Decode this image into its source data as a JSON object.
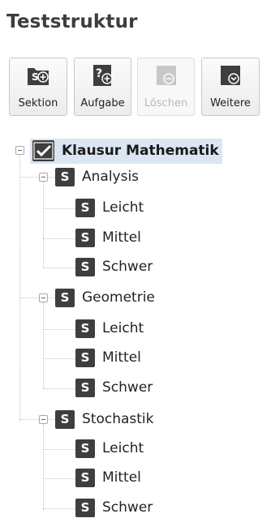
{
  "header": {
    "title": "Teststruktur"
  },
  "toolbar": {
    "buttons": [
      {
        "label": "Sektion",
        "icon": "add-section-icon",
        "enabled": true
      },
      {
        "label": "Aufgabe",
        "icon": "add-task-icon",
        "enabled": true
      },
      {
        "label": "Löschen",
        "icon": "delete-icon",
        "enabled": false
      },
      {
        "label": "Weitere",
        "icon": "more-dropdown-icon",
        "enabled": true
      }
    ]
  },
  "tree": {
    "root": {
      "label": "Klausur Mathematik",
      "icon": "checkbox-checked-icon",
      "selected": true
    },
    "section_icon_letter": "S",
    "sections": [
      {
        "label": "Analysis",
        "children": [
          "Leicht",
          "Mittel",
          "Schwer"
        ]
      },
      {
        "label": "Geometrie",
        "children": [
          "Leicht",
          "Mittel",
          "Schwer"
        ]
      },
      {
        "label": "Stochastik",
        "children": [
          "Leicht",
          "Mittel",
          "Schwer"
        ]
      }
    ]
  },
  "colors": {
    "icon_dark": "#3e3e3e",
    "selection_bg": "#dbe6f2",
    "title": "#3d3d3d"
  }
}
